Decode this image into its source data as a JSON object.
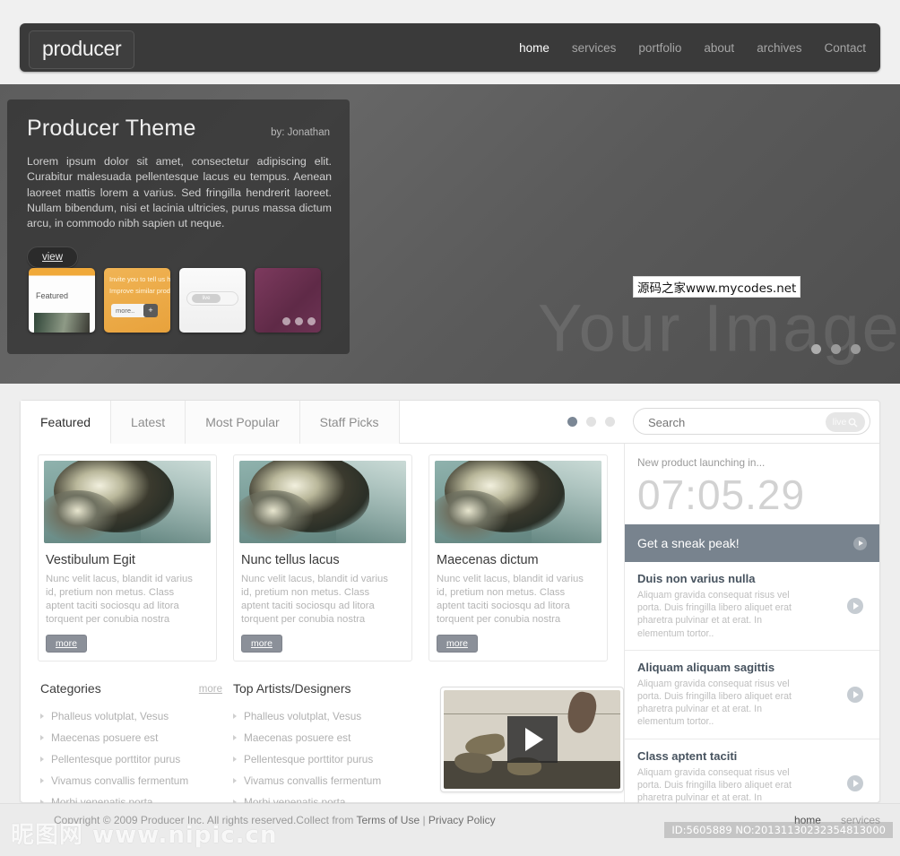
{
  "brand": {
    "logo": "producer"
  },
  "nav": {
    "items": [
      {
        "label": "home",
        "active": true
      },
      {
        "label": "services",
        "active": false
      },
      {
        "label": "portfolio",
        "active": false
      },
      {
        "label": "about",
        "active": false
      },
      {
        "label": "archives",
        "active": false
      },
      {
        "label": "Contact",
        "active": false
      }
    ]
  },
  "hero": {
    "title": "Producer Theme",
    "byline": "by: Jonathan",
    "description": "Lorem ipsum dolor sit amet, consectetur adipiscing elit. Curabitur malesuada pellentesque lacus eu tempus. Aenean laoreet mattis lorem a varius. Sed fringilla hendrerit laoreet. Nullam bibendum, nisi et lacinia ultricies, purus massa dictum arcu, in commodo nibh sapien ut neque.",
    "view_label": "view",
    "placeholder_text": "Your Image",
    "watermark": "源码之家www.mycodes.net",
    "thumbs": [
      {
        "name": "thumb-featured",
        "label": "Featured"
      },
      {
        "name": "thumb-invite",
        "line1": "Invite you to tell us h",
        "line2": "Improve similar prod",
        "more": "more..",
        "plus": "+"
      },
      {
        "name": "thumb-search",
        "pill": "live"
      },
      {
        "name": "thumb-purple"
      }
    ],
    "dots": 3,
    "active_dot": 0
  },
  "tabs": {
    "items": [
      {
        "label": "Featured",
        "active": true
      },
      {
        "label": "Latest",
        "active": false
      },
      {
        "label": "Most Popular",
        "active": false
      },
      {
        "label": "Staff Picks",
        "active": false
      }
    ],
    "dots": 3,
    "active_dot": 0
  },
  "search": {
    "placeholder": "Search",
    "value": "",
    "button_label": "live"
  },
  "cards": [
    {
      "title": "Vestibulum Egit",
      "text": "Nunc velit lacus, blandit id varius id, pretium non metus. Class aptent taciti sociosqu ad litora torquent per conubia nostra",
      "more": "more"
    },
    {
      "title": "Nunc tellus lacus",
      "text": "Nunc velit lacus, blandit id varius id, pretium non metus. Class aptent taciti sociosqu ad litora torquent per conubia nostra",
      "more": "more"
    },
    {
      "title": "Maecenas dictum",
      "text": "Nunc velit lacus, blandit id varius id, pretium non metus. Class aptent taciti sociosqu ad litora torquent per conubia nostra",
      "more": "more"
    }
  ],
  "categories": {
    "heading": "Categories",
    "more": "more",
    "items": [
      "Phalleus volutplat, Vesus",
      "Maecenas posuere est",
      "Pellentesque porttitor purus",
      "Vivamus convallis fermentum",
      "Morbi venenatis porta"
    ]
  },
  "artists": {
    "heading": "Top Artists/Designers",
    "items": [
      "Phalleus volutplat, Vesus",
      "Maecenas posuere est",
      "Pellentesque porttitor purus",
      "Vivamus convallis fermentum",
      "Morbi venenatis porta"
    ]
  },
  "countdown": {
    "label": "New product launching in...",
    "time": "07:05.29",
    "cta": "Get a sneak peak!"
  },
  "news": [
    {
      "title": "Duis non varius nulla",
      "text": "Aliquam gravida consequat risus vel porta. Duis fringilla libero aliquet erat pharetra pulvinar et at erat. In elementum tortor.."
    },
    {
      "title": "Aliquam aliquam sagittis",
      "text": "Aliquam gravida consequat risus vel porta. Duis fringilla libero aliquet erat pharetra pulvinar et at erat. In elementum tortor.."
    },
    {
      "title": "Class aptent taciti",
      "text": "Aliquam gravida consequat risus vel porta. Duis fringilla libero aliquet erat pharetra pulvinar et at erat. In elementum tortor.."
    }
  ],
  "footer": {
    "copyright": "Copyright © 2009 Producer Inc. All rights reserved.Collect from ",
    "terms": "Terms of Use",
    "sep": " | ",
    "privacy": "Privacy Policy",
    "nav": [
      {
        "label": "home",
        "active": true
      },
      {
        "label": "services",
        "active": false
      }
    ],
    "nipic_watermark": "昵图网 www.nipic.cn",
    "id_watermark": "ID:5605889 NO:20131130232354813000"
  },
  "colors": {
    "header_bg": "#3a3a3a",
    "hero_bg": "#5d5d5d",
    "accent": "#78838e",
    "more_button": "#8b9099",
    "news_title": "#47535f",
    "thumb_orange": "#f0b455",
    "thumb_purple": "#6d3354"
  }
}
